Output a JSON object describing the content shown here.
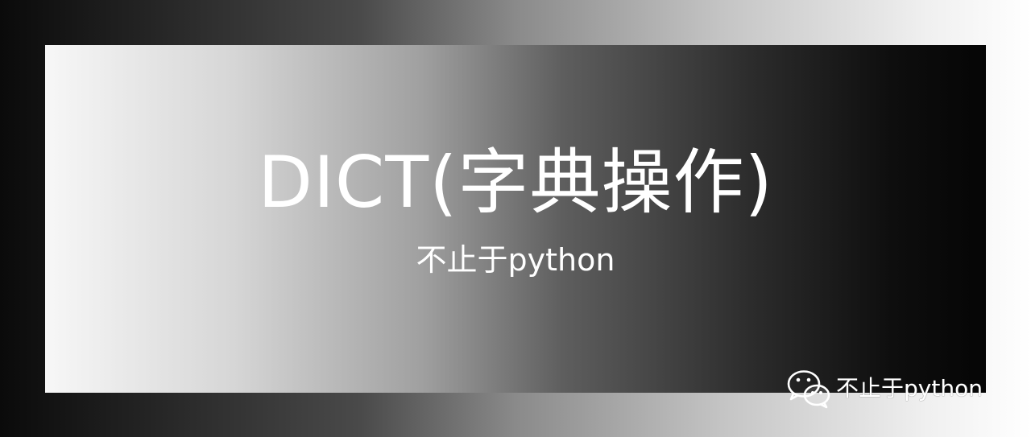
{
  "banner": {
    "title": "DICT(字典操作)",
    "subtitle": "不止于python"
  },
  "watermark": {
    "icon": "wechat-icon",
    "text": "不止于python"
  },
  "colors": {
    "text": "#ffffff",
    "outer_dark": "#0a0a0a",
    "outer_light": "#ffffff",
    "panel_light": "#f7f7f7",
    "panel_dark": "#050505"
  }
}
